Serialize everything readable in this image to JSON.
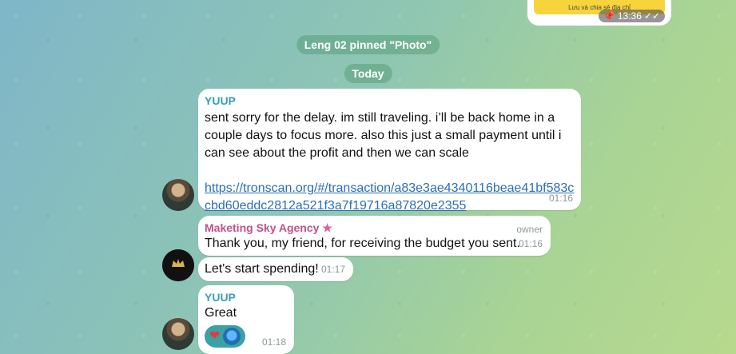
{
  "top_message": {
    "caption": "Lưu và chia sẻ địa chỉ",
    "time": "13:36",
    "pin_icon": "pin-icon",
    "read_icon": "double-check-icon"
  },
  "service": {
    "pinned_sender": "Leng 02",
    "pinned_rest": " pinned \"Photo\"",
    "date_chip": "Today"
  },
  "messages": [
    {
      "sender": "YUUP",
      "text": "sent sorry for the delay. im still traveling. i’ll be back home in a couple days to focus more. also this just a small payment until i can see about the profit and then we can scale",
      "link": "https://tronscan.org/#/transaction/a83e3ae4340116beae41bf583ccbd60eddc2812a521f3a7f19716a87820e2355",
      "time": "01:16"
    },
    {
      "sender": "Maketing Sky Agency",
      "role": "owner",
      "text": "Thank you, my friend, for receiving the budget you sent.",
      "time": "01:16"
    },
    {
      "text": "Let's start spending!",
      "time": "01:17"
    },
    {
      "sender": "YUUP",
      "text": "Great",
      "time": "01:18",
      "reactions": [
        "heart-icon",
        "reactor-avatar"
      ]
    }
  ],
  "colors": {
    "teal_sender": "#3a9fb2",
    "pink_sender": "#c4508a",
    "link": "#2a6fb5",
    "reaction_bg": "#3aa1a6"
  }
}
